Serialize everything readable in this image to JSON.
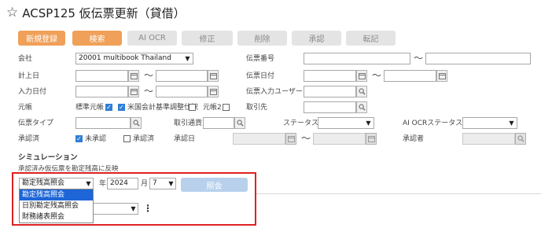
{
  "header": {
    "title": "ACSP125 仮伝票更新（貸借）"
  },
  "toolbar": {
    "new": "新規登録",
    "search": "検索",
    "ai_ocr": "AI OCR",
    "edit": "修正",
    "delete": "削除",
    "approve": "承認",
    "post": "転記"
  },
  "form": {
    "company_label": "会社",
    "company_value": "20001 multibook Thailand",
    "voucher_no_label": "伝票番号",
    "posting_date_label": "計上日",
    "voucher_date_label": "伝票日付",
    "entry_date_label": "入力日付",
    "entry_user_label": "伝票入力ユーザー",
    "ledger_label": "元帳",
    "ledger_std": "標準元帳",
    "ledger_us": "米国会計基準調整仕訳",
    "ledger_2": "元帳2",
    "partner_label": "取引先",
    "voucher_type_label": "伝票タイプ",
    "currency_label": "取引通貨",
    "status_label": "ステータス",
    "ai_ocr_status_label": "AI OCRステータス",
    "approved_label": "承認済",
    "unapproved": "未承認",
    "approved": "承認済",
    "approval_date_label": "承認日",
    "approver_label": "承認者",
    "tilde": "～"
  },
  "simulation": {
    "title": "シミュレーション",
    "subtitle": "承認済み仮伝票を勘定残高に反映",
    "report_select": "勘定残高照会",
    "year_label": "年",
    "year_value": "2024",
    "month_label": "月",
    "month_value": "7",
    "apply": "照会",
    "options": [
      "勘定残高照会",
      "日別勘定残高照会",
      "財務諸表照会"
    ]
  }
}
